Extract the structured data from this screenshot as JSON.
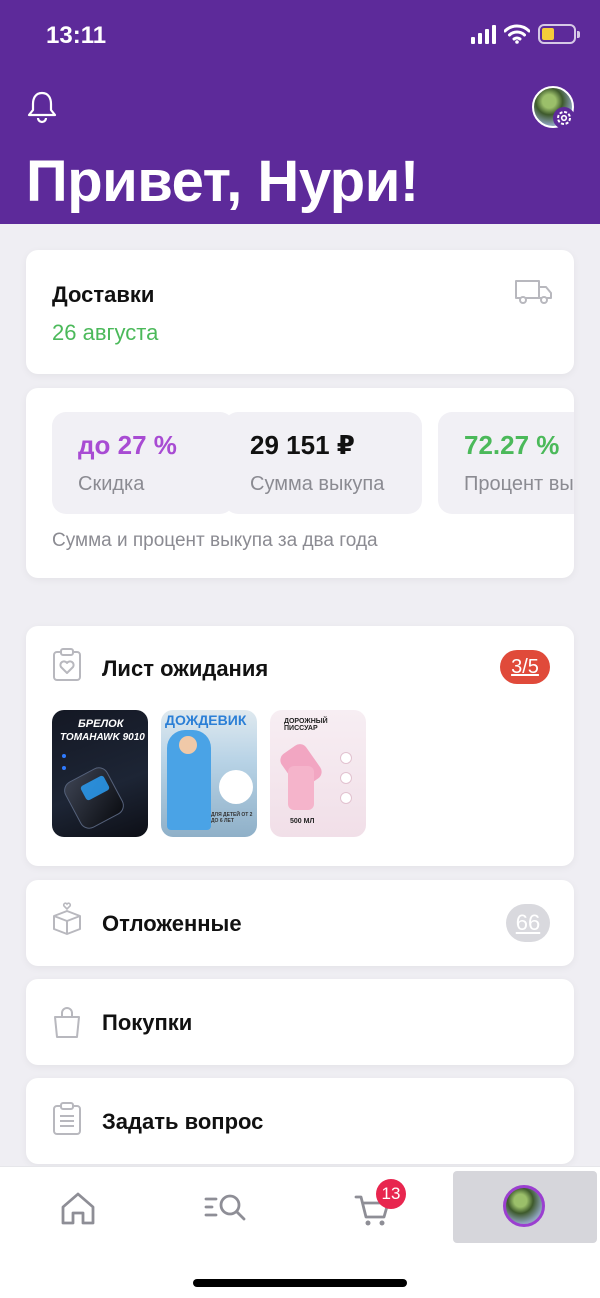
{
  "status_bar": {
    "time": "13:11"
  },
  "header": {
    "greeting": "Привет, Нури!"
  },
  "delivery": {
    "title": "Доставки",
    "date": "26 августа"
  },
  "stats": {
    "items": [
      {
        "value": "до 27 %",
        "label": "Скидка"
      },
      {
        "value": "29 151 ₽",
        "label": "Сумма выкупа"
      },
      {
        "value": "72.27 %",
        "label": "Процент выкупа"
      }
    ],
    "note": "Сумма и процент выкупа за два года"
  },
  "waitlist": {
    "title": "Лист ожидания",
    "badge": "3/5",
    "products": [
      {
        "line1": "БРЕЛОК",
        "line2": "TOMAHAWK 9010"
      },
      {
        "line1": "ДОЖДЕВИК",
        "line2": "ДЛЯ ДЕТЕЙ ОТ 2 ДО 6 ЛЕТ"
      },
      {
        "line1": "ДОРОЖНЫЙ ПИССУАР",
        "line2": "500 МЛ"
      }
    ]
  },
  "menu": {
    "postponed": {
      "label": "Отложенные",
      "count": "66"
    },
    "purchases": {
      "label": "Покупки"
    },
    "question": {
      "label": "Задать вопрос"
    }
  },
  "tabbar": {
    "cart_count": "13"
  },
  "colors": {
    "brand": "#5d2a9a",
    "green": "#4bb95a",
    "purple_text": "#a84bd3",
    "badge_red": "#e04a3a",
    "cart_badge": "#e8264f"
  },
  "icons": [
    "bell-icon",
    "settings-gear-icon",
    "truck-icon",
    "clipboard-heart-icon",
    "box-heart-icon",
    "shopping-bag-icon",
    "clipboard-list-icon",
    "home-icon",
    "catalog-search-icon",
    "cart-icon"
  ]
}
